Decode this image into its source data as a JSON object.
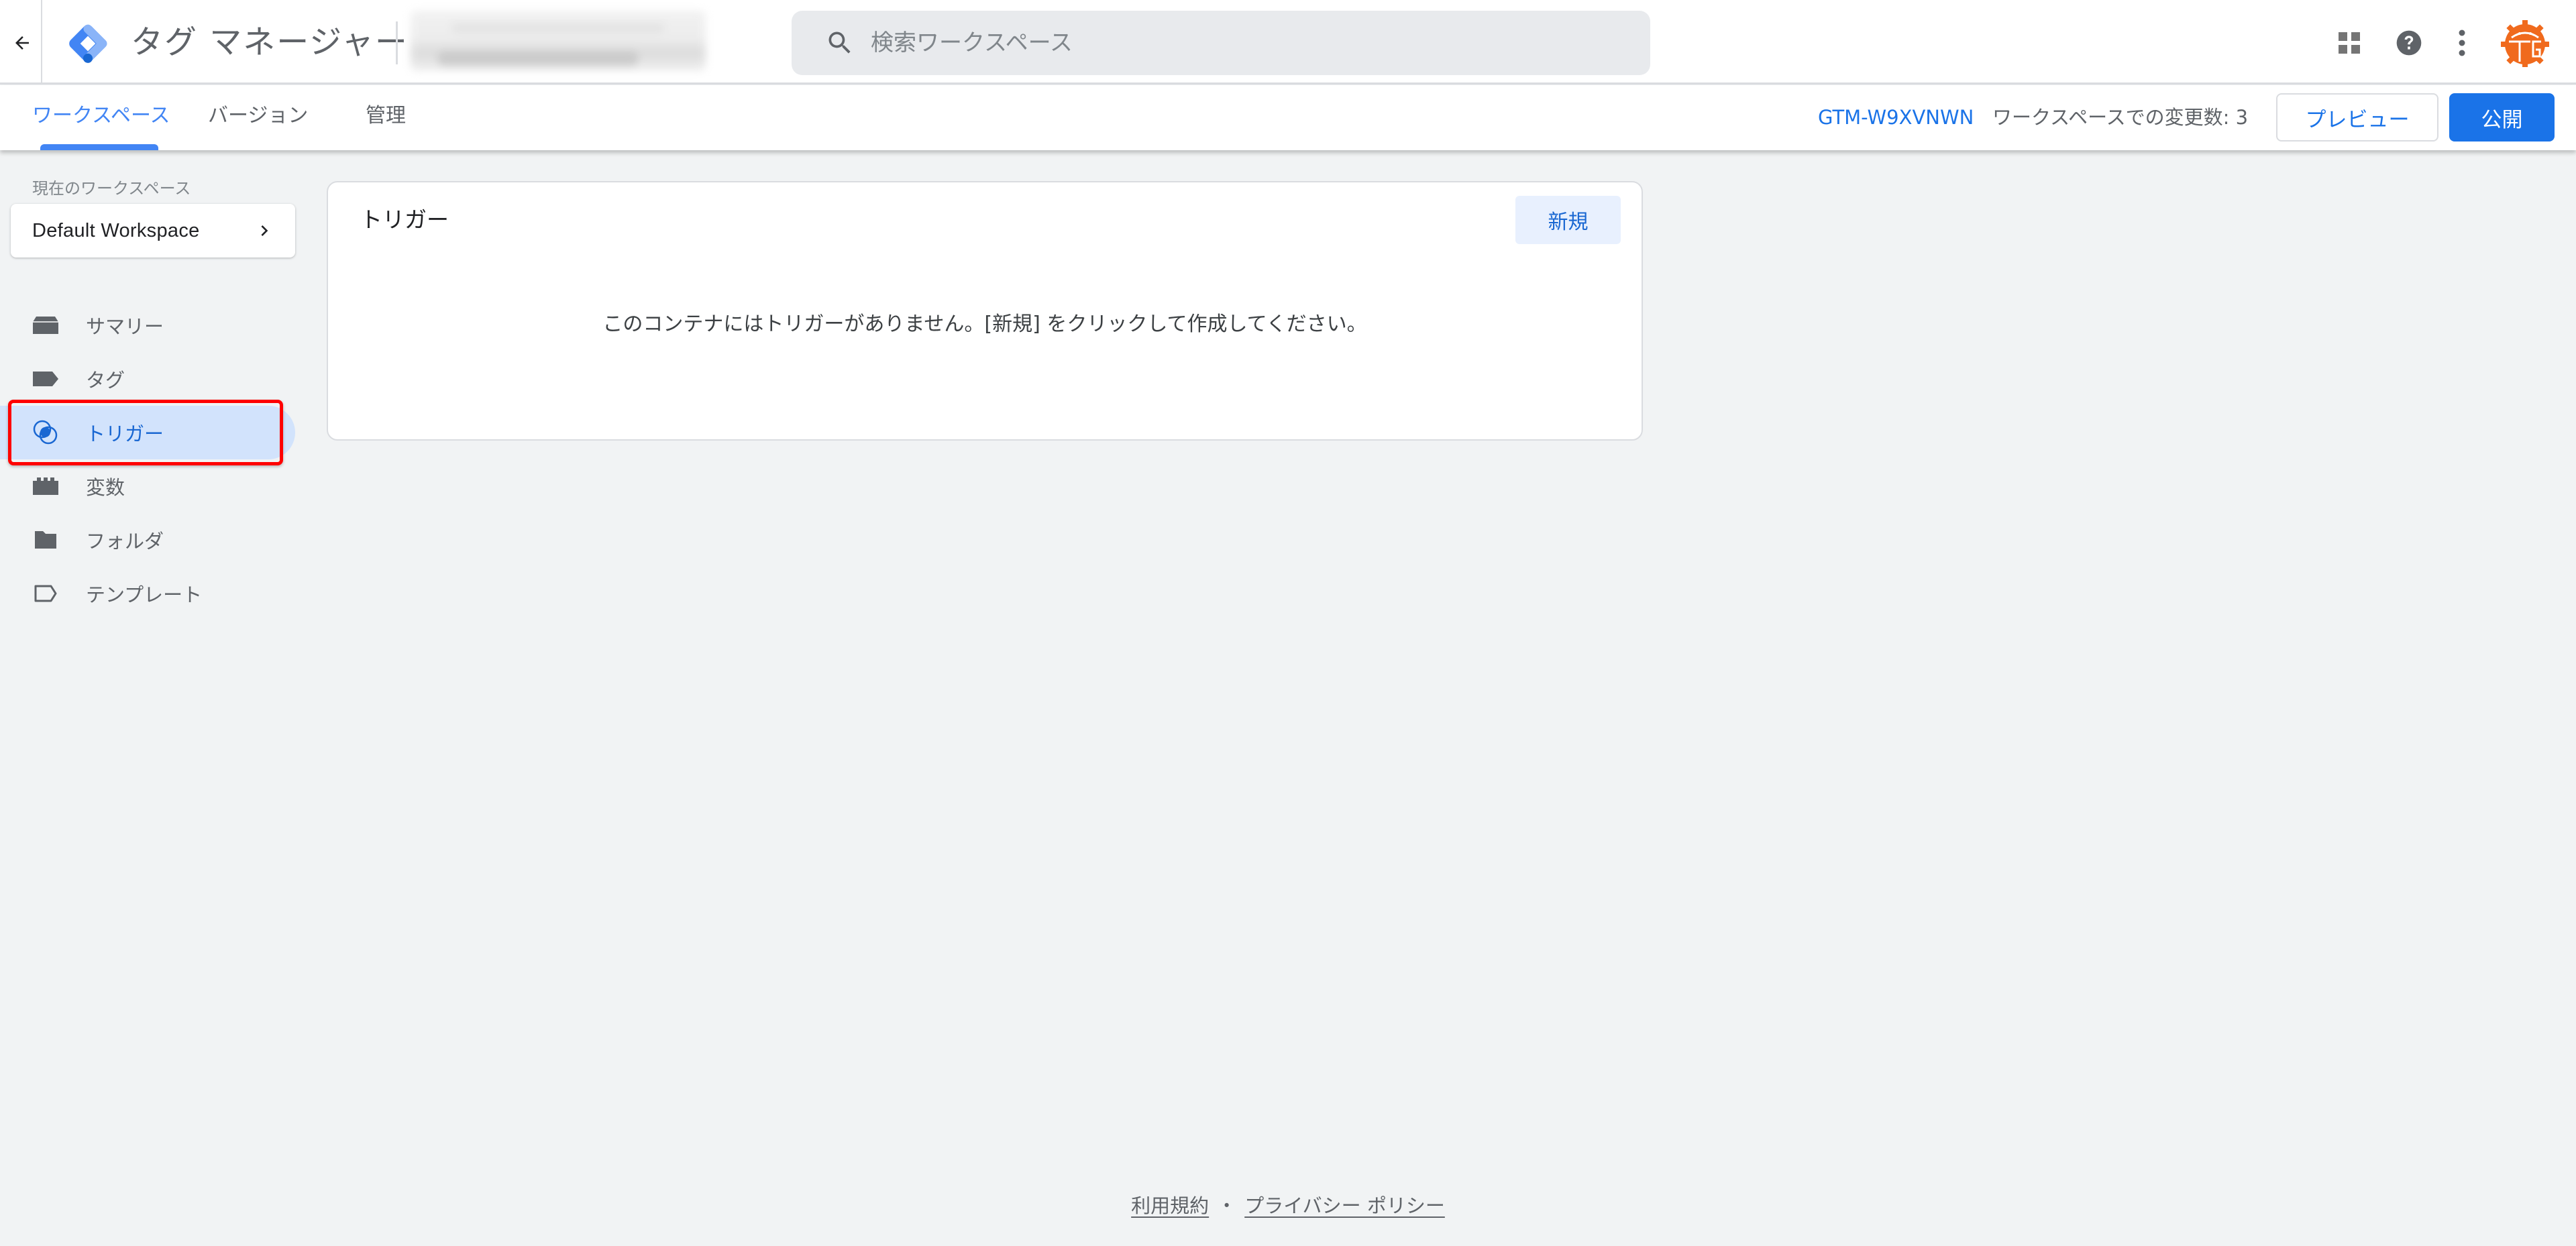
{
  "header": {
    "back_icon": "arrow-back-icon",
    "logo_icon": "tag-manager-logo",
    "app_title": "タグ マネージャー",
    "search": {
      "placeholder": "検索ワークスペース",
      "value": ""
    },
    "icons": [
      "apps-grid-icon",
      "help-icon",
      "more-vert-icon",
      "avatar"
    ],
    "colors": {
      "logo_light": "#8ab4f8",
      "logo_mid": "#4285f4",
      "logo_dark": "#1967d2",
      "avatar": "#f06a1d"
    }
  },
  "tabbar": {
    "tabs": [
      {
        "label": "ワークスペース",
        "active": true
      },
      {
        "label": "バージョン",
        "active": false
      },
      {
        "label": "管理",
        "active": false
      }
    ],
    "container_id": "GTM-W9XVNWN",
    "change_count_label": "ワークスペースでの変更数: 3",
    "preview_label": "プレビュー",
    "publish_label": "公開",
    "accent": "#1a73e8"
  },
  "sidebar": {
    "workspace_label": "現在のワークスペース",
    "workspace_name": "Default Workspace",
    "items": [
      {
        "label": "サマリー",
        "icon": "summary-icon",
        "active": false
      },
      {
        "label": "タグ",
        "icon": "tag-icon",
        "active": false
      },
      {
        "label": "トリガー",
        "icon": "trigger-icon",
        "active": true
      },
      {
        "label": "変数",
        "icon": "variables-icon",
        "active": false
      },
      {
        "label": "フォルダ",
        "icon": "folder-icon",
        "active": false
      },
      {
        "label": "テンプレート",
        "icon": "template-icon",
        "active": false
      }
    ],
    "highlight_color": "#ff0000"
  },
  "main": {
    "card_title": "トリガー",
    "new_button_label": "新規",
    "empty_message": "このコンテナにはトリガーがありません。[新規] をクリックして作成してください。"
  },
  "footer": {
    "terms_label": "利用規約",
    "separator": "・",
    "privacy_label": "プライバシー ポリシー"
  }
}
